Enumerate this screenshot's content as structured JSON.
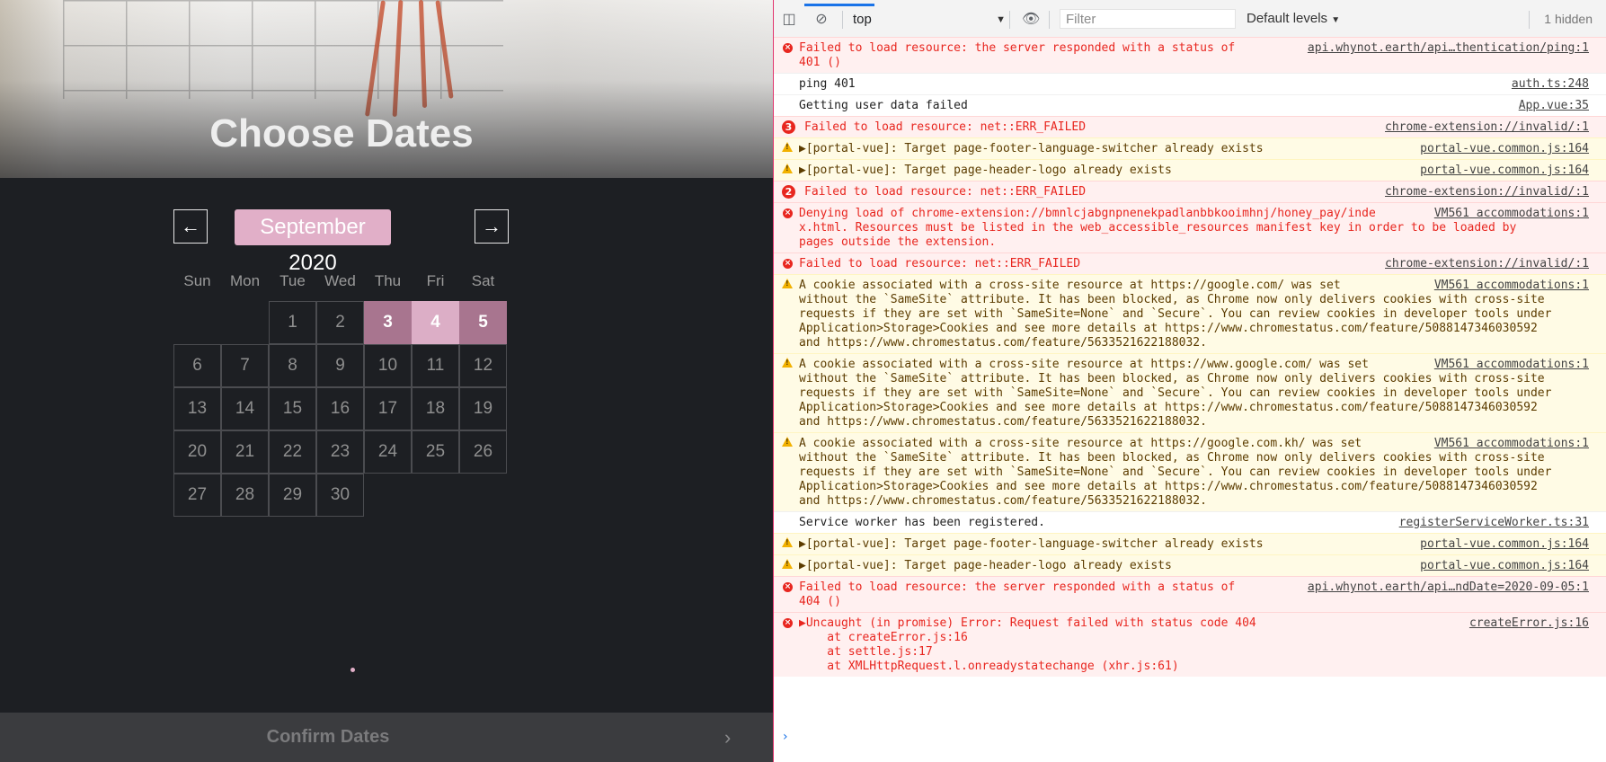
{
  "app": {
    "title": "Choose Dates",
    "month": "September 2020",
    "prev_icon": "arrow-left-icon",
    "next_icon": "arrow-right-icon",
    "weekdays": [
      "Sun",
      "Mon",
      "Tue",
      "Wed",
      "Thu",
      "Fri",
      "Sat"
    ],
    "days": [
      "1",
      "2",
      "3",
      "4",
      "5",
      "6",
      "7",
      "8",
      "9",
      "10",
      "11",
      "12",
      "13",
      "14",
      "15",
      "16",
      "17",
      "18",
      "19",
      "20",
      "21",
      "22",
      "23",
      "24",
      "25",
      "26",
      "27",
      "28",
      "29",
      "30"
    ],
    "selected_days": [
      "3",
      "4",
      "5"
    ],
    "confirm_label": "Confirm Dates",
    "confirm_icon": "chevron-right-icon",
    "accent": "#e1afc8"
  },
  "devtools": {
    "context": "top",
    "filter_placeholder": "Filter",
    "levels": "Default levels",
    "hidden": "1 hidden",
    "messages": [
      {
        "level": "error",
        "text": "Failed to load resource: the server responded with a status of\n401 ()",
        "src": "api.whynot.earth/api…thentication/ping:1"
      },
      {
        "level": "info",
        "text": "ping 401",
        "src": "auth.ts:248"
      },
      {
        "level": "info",
        "text": "Getting user data failed",
        "src": "App.vue:35"
      },
      {
        "level": "error",
        "count": "3",
        "text": "Failed to load resource: net::ERR_FAILED",
        "src": "chrome-extension://invalid/:1"
      },
      {
        "level": "warn",
        "text": "▶[portal-vue]: Target page-footer-language-switcher already exists",
        "src": "portal-vue.common.js:164"
      },
      {
        "level": "warn",
        "text": "▶[portal-vue]: Target page-header-logo already exists",
        "src": "portal-vue.common.js:164"
      },
      {
        "level": "error",
        "count": "2",
        "text": "Failed to load resource: net::ERR_FAILED",
        "src": "chrome-extension://invalid/:1"
      },
      {
        "level": "error",
        "text": "Denying load of chrome-extension://bmnlcjabgnpnenekpadlanbbkooimhnj/honey_pay/inde\nx.html. Resources must be listed in the web_accessible_resources manifest key in order to be loaded by\npages outside the extension.",
        "src": "VM561 accommodations:1"
      },
      {
        "level": "error",
        "text": "Failed to load resource: net::ERR_FAILED",
        "src": "chrome-extension://invalid/:1"
      },
      {
        "level": "warn",
        "text": "A cookie associated with a cross-site resource at https://google.com/ was set\nwithout the `SameSite` attribute. It has been blocked, as Chrome now only delivers cookies with cross-site\nrequests if they are set with `SameSite=None` and `Secure`. You can review cookies in developer tools under\nApplication>Storage>Cookies and see more details at https://www.chromestatus.com/feature/5088147346030592\nand https://www.chromestatus.com/feature/5633521622188032.",
        "src": "VM561 accommodations:1"
      },
      {
        "level": "warn",
        "text": "A cookie associated with a cross-site resource at https://www.google.com/ was set\nwithout the `SameSite` attribute. It has been blocked, as Chrome now only delivers cookies with cross-site\nrequests if they are set with `SameSite=None` and `Secure`. You can review cookies in developer tools under\nApplication>Storage>Cookies and see more details at https://www.chromestatus.com/feature/5088147346030592\nand https://www.chromestatus.com/feature/5633521622188032.",
        "src": "VM561 accommodations:1"
      },
      {
        "level": "warn",
        "text": "A cookie associated with a cross-site resource at https://google.com.kh/ was set\nwithout the `SameSite` attribute. It has been blocked, as Chrome now only delivers cookies with cross-site\nrequests if they are set with `SameSite=None` and `Secure`. You can review cookies in developer tools under\nApplication>Storage>Cookies and see more details at https://www.chromestatus.com/feature/5088147346030592\nand https://www.chromestatus.com/feature/5633521622188032.",
        "src": "VM561 accommodations:1"
      },
      {
        "level": "info",
        "text": "Service worker has been registered.",
        "src": "registerServiceWorker.ts:31"
      },
      {
        "level": "warn",
        "text": "▶[portal-vue]: Target page-footer-language-switcher already exists",
        "src": "portal-vue.common.js:164"
      },
      {
        "level": "warn",
        "text": "▶[portal-vue]: Target page-header-logo already exists",
        "src": "portal-vue.common.js:164"
      },
      {
        "level": "error",
        "text": "Failed to load resource: the server responded with a status of\n404 ()",
        "src": "api.whynot.earth/api…ndDate=2020-09-05:1"
      },
      {
        "level": "error",
        "text": "▶Uncaught (in promise) Error: Request failed with status code 404\n    at createError.js:16\n    at settle.js:17\n    at XMLHttpRequest.l.onreadystatechange (xhr.js:61)",
        "src": "createError.js:16"
      }
    ],
    "prompt": "›"
  }
}
